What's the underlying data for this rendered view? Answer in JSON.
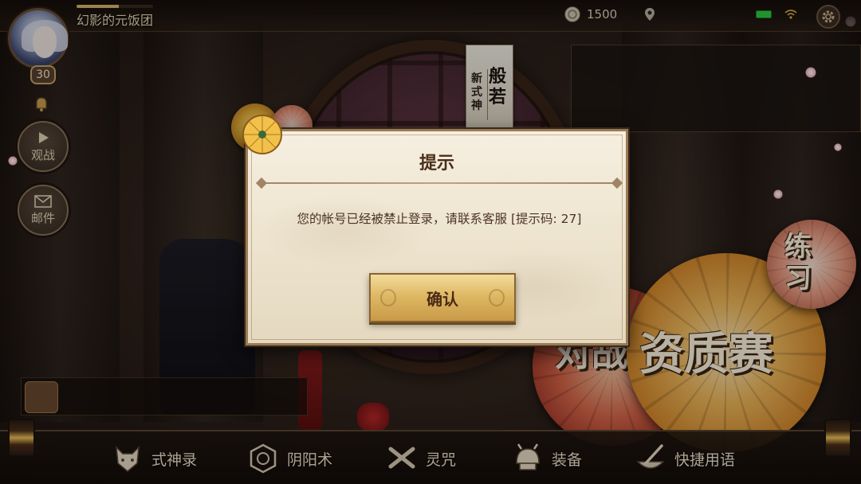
{
  "player": {
    "name": "幻影的元饭团",
    "level": "30",
    "xp_fraction": 0.55
  },
  "topbar": {
    "currency_value": "1500",
    "currency_icon": "coin-icon",
    "location_icon": "location-pin-icon",
    "battery_icon": "battery-icon",
    "wifi_icon": "wifi-icon",
    "settings_icon": "gear-icon"
  },
  "side_menu": {
    "watch_label": "观战",
    "mail_label": "邮件"
  },
  "shikigami_tag": {
    "prefix": "新式神",
    "name": "般若"
  },
  "event_labels": {
    "practice": "练习",
    "qualifier": "资质赛",
    "battle": "对战"
  },
  "bottom_nav": [
    {
      "label": "式神录",
      "icon": "fox-mask-icon"
    },
    {
      "label": "阴阳术",
      "icon": "onmyoji-seal-icon"
    },
    {
      "label": "灵咒",
      "icon": "crossed-blades-icon"
    },
    {
      "label": "装备",
      "icon": "samurai-helmet-icon"
    },
    {
      "label": "快捷用语",
      "icon": "brush-bowl-icon"
    }
  ],
  "dialog": {
    "title": "提示",
    "message": "您的帐号已经被禁止登录，请联系客服 [提示码: 27]",
    "confirm_label": "确认"
  },
  "colors": {
    "dialog_bg": "#f0e7d4",
    "button_gold": "#dfb864",
    "title_brown": "#4a2e1a",
    "accent_green": "#2ecc40"
  }
}
